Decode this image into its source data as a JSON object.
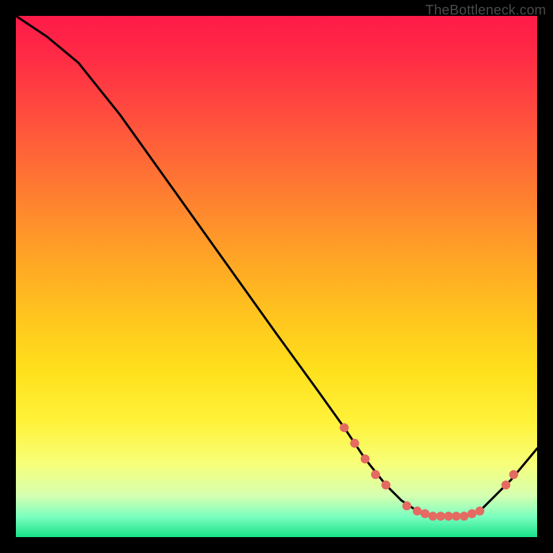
{
  "attribution": "TheBottleneck.com",
  "chart_data": {
    "type": "line",
    "title": "",
    "xlabel": "",
    "ylabel": "",
    "xlim": [
      0,
      100
    ],
    "ylim": [
      0,
      100
    ],
    "grid": false,
    "series": [
      {
        "name": "curve",
        "x": [
          0,
          6,
          12,
          20,
          30,
          40,
          50,
          58,
          63,
          67,
          71,
          74,
          77,
          80,
          83,
          86,
          89,
          92,
          95,
          100
        ],
        "y": [
          100,
          96,
          91,
          81,
          67,
          53,
          39,
          28,
          21,
          15,
          10,
          7,
          5,
          4,
          4,
          4,
          5,
          8,
          11,
          17
        ]
      }
    ],
    "markers": [
      {
        "x": 63,
        "y": 21
      },
      {
        "x": 65,
        "y": 18
      },
      {
        "x": 67,
        "y": 15
      },
      {
        "x": 69,
        "y": 12
      },
      {
        "x": 71,
        "y": 10
      },
      {
        "x": 75,
        "y": 6
      },
      {
        "x": 77,
        "y": 5
      },
      {
        "x": 78.5,
        "y": 4.5
      },
      {
        "x": 80,
        "y": 4
      },
      {
        "x": 81.5,
        "y": 4
      },
      {
        "x": 83,
        "y": 4
      },
      {
        "x": 84.5,
        "y": 4
      },
      {
        "x": 86,
        "y": 4
      },
      {
        "x": 87.5,
        "y": 4.5
      },
      {
        "x": 89,
        "y": 5
      },
      {
        "x": 94,
        "y": 10
      },
      {
        "x": 95.5,
        "y": 12
      }
    ],
    "colors": {
      "curve": "#000000",
      "marker": "#e46a62"
    }
  }
}
